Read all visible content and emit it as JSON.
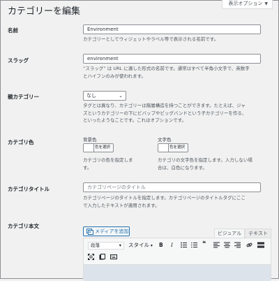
{
  "screen_options": {
    "label": "表示オプション",
    "arrow": "▼"
  },
  "page_title": "カテゴリーを編集",
  "name": {
    "label": "名前",
    "value": "Environment",
    "desc": "カテゴリーとしてウィジェットやラベル等で表示される名前です。"
  },
  "slug": {
    "label": "スラッグ",
    "value": "environment",
    "desc_line1": "“スラッグ” は URL に適した形式の名前です。通常はすべて半角小文字で、英数字",
    "desc_line2": "とハイフンのみが使われます。"
  },
  "parent": {
    "label": "親カテゴリー",
    "selected": "なし",
    "desc_line1": "タグとは異なり、カテゴリーは階層構造を持つことができます。たとえば、ジャ",
    "desc_line2": "ズというカテゴリーの下にビバップやビッグバンドという子カテゴリーを作る、",
    "desc_line3": "といったようなことです。これはオプションです。"
  },
  "category_color": {
    "label": "カテゴリ色",
    "bg_label": "背景色",
    "text_label": "文字色",
    "button_label": "色を選択",
    "bg_desc_line1": "カテゴリの色を指定しま",
    "bg_desc_line2": "す。",
    "text_desc_line1": "カテゴリの文字色を指定します。入力しない場",
    "text_desc_line2": "合は、白色になります。"
  },
  "category_title": {
    "label": "カテゴリタイトル",
    "placeholder": "カテゴリページのタイトル",
    "desc_line1": "カテゴリページのタイトルを指定します。カテゴリページのタイトルタグにここ",
    "desc_line2": "で入力したテキストが適用されます。"
  },
  "category_body": {
    "label": "カテゴリ本文",
    "add_media": "メディアを追加",
    "tab_visual": "ビジュアル",
    "tab_text": "テキスト",
    "format_select": "段落",
    "style_select": "スタイル"
  }
}
